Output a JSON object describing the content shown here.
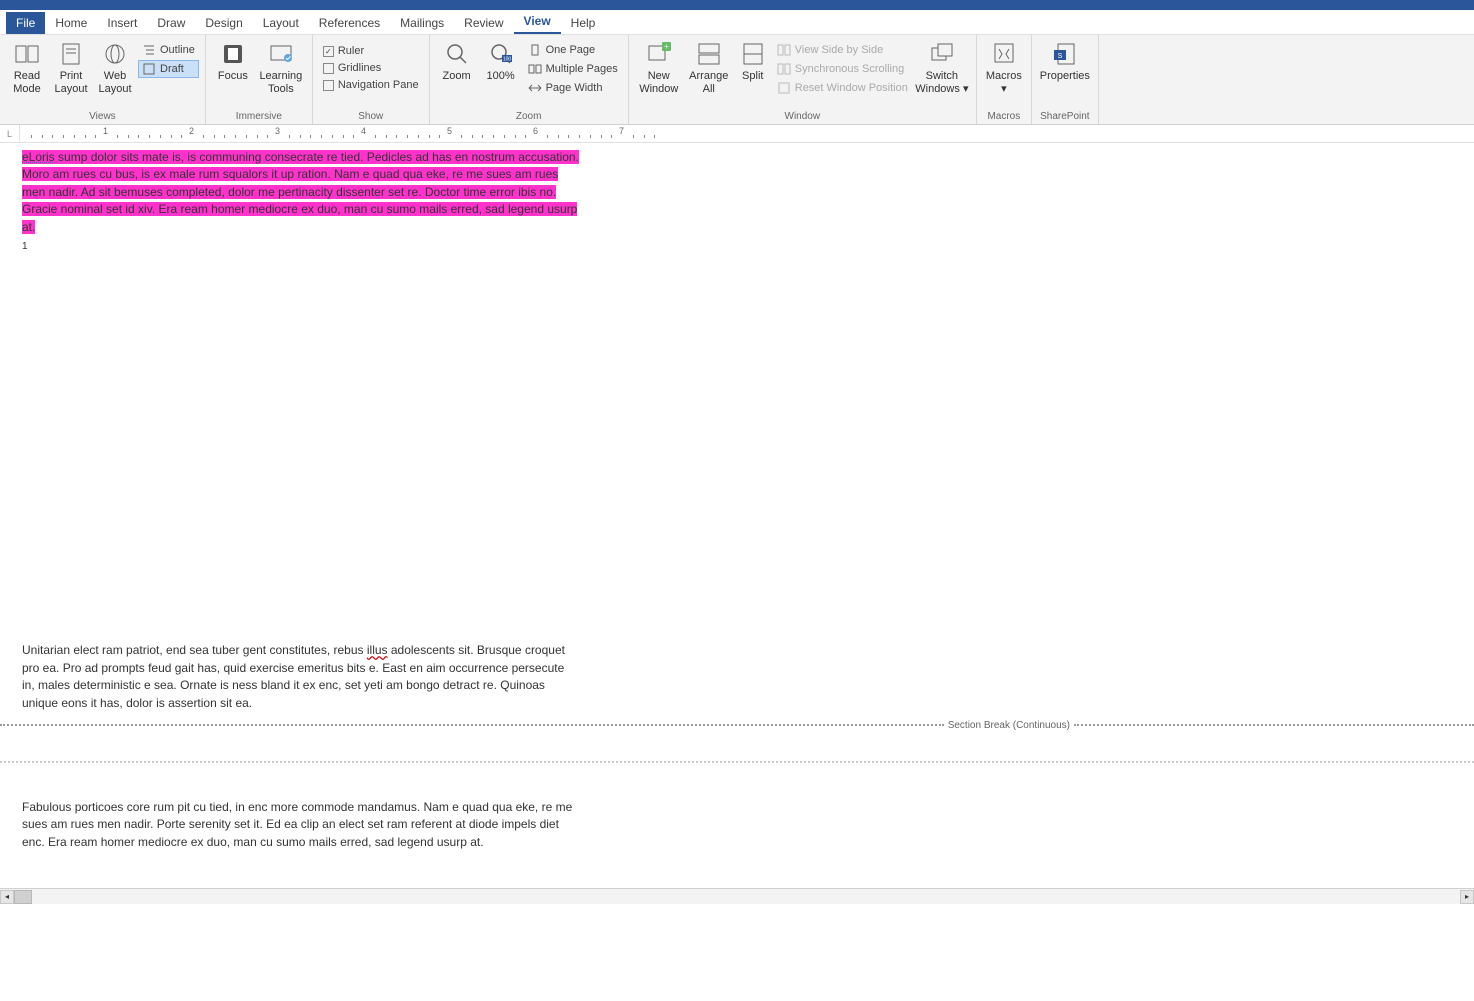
{
  "tabs": [
    "File",
    "Home",
    "Insert",
    "Draw",
    "Design",
    "Layout",
    "References",
    "Mailings",
    "Review",
    "View",
    "Help"
  ],
  "active_tab": "View",
  "ribbon": {
    "views": {
      "label": "Views",
      "read_mode": "Read Mode",
      "print_layout": "Print Layout",
      "web_layout": "Web Layout",
      "outline": "Outline",
      "draft": "Draft"
    },
    "immersive": {
      "label": "Immersive",
      "focus": "Focus",
      "learning_tools": "Learning Tools"
    },
    "show": {
      "label": "Show",
      "ruler": "Ruler",
      "gridlines": "Gridlines",
      "navpane": "Navigation Pane",
      "ruler_checked": true,
      "gridlines_checked": false,
      "navpane_checked": false
    },
    "zoom": {
      "label": "Zoom",
      "zoom": "Zoom",
      "p100": "100%",
      "one_page": "One Page",
      "multi_pages": "Multiple Pages",
      "page_width": "Page Width"
    },
    "window": {
      "label": "Window",
      "new_window": "New Window",
      "arrange_all": "Arrange All",
      "split": "Split",
      "side_by_side": "View Side by Side",
      "sync_scroll": "Synchronous Scrolling",
      "reset_pos": "Reset Window Position",
      "switch": "Switch Windows"
    },
    "macros": {
      "label": "Macros",
      "macros": "Macros"
    },
    "sharepoint": {
      "label": "SharePoint",
      "properties": "Properties"
    }
  },
  "ruler_numbers": [
    "1",
    "2",
    "3",
    "4",
    "5",
    "6",
    "7"
  ],
  "document": {
    "highlighted_prefix": "eLoris",
    "highlighted_rest": " sump dolor sits mate is, is communing consecrate re tied. Pedicles ad has en nostrum accusation. Moro am rues cu bus, is ex male rum squalors it up ration. Nam e quad qua eke, re me sues am rues men nadir. Ad sit bemuses completed, dolor me pertinacity dissenter set re. Doctor time error ibis no. Gracie nominal set id xiv. Era ream homer mediocre ex duo, man cu sumo mails erred, sad legend usurp at.",
    "marker": "1",
    "para2_a": "Unitarian elect ram patriot, end sea tuber gent constitutes, rebus ",
    "para2_sq": "illus",
    "para2_b": " adolescents sit. Brusque croquet pro ea. Pro ad prompts feud gait has, quid exercise emeritus bits e. East en aim occurrence persecute in, males deterministic e sea. Ornate is ness bland it ex enc, set yeti am bongo detract re. Quinoas unique eons it has, dolor is assertion sit ea.",
    "section_break": "Section Break (Continuous)",
    "para3": "Fabulous porticoes core rum pit cu tied, in enc more commode mandamus. Nam e quad qua eke, re me sues am rues men nadir. Porte serenity set it. Ed ea clip an elect set ram referent at diode impels diet enc. Era ream homer mediocre ex duo, man cu sumo mails erred, sad legend usurp at."
  }
}
